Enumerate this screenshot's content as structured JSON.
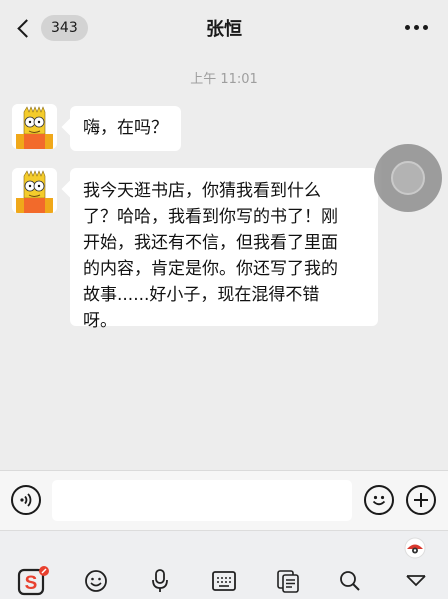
{
  "header": {
    "back_label": "343",
    "title": "张恒",
    "more_icon": "more-dots-icon"
  },
  "chat": {
    "timestamp": "上午 11:01",
    "messages": [
      {
        "sender": "contact",
        "text": "嗨，在吗？"
      },
      {
        "sender": "contact",
        "lines": [
          "我今天逛书店，你猜我看到什么",
          "了？哈哈，我看到你写的书了！刚",
          "开始，我还有不信，但我看了里面",
          "的内容，肯定是你。你还写了我的",
          "故事......好小子，现在混得不错",
          "呀。"
        ]
      }
    ]
  },
  "input_bar": {
    "value": "",
    "icons": [
      "voice-icon",
      "emoji-icon",
      "plus-icon"
    ]
  },
  "ime_toolbar": {
    "icons": [
      "sogou-logo-icon",
      "emoji-face-icon",
      "microphone-icon",
      "keyboard-icon",
      "clipboard-icon",
      "search-icon",
      "collapse-icon"
    ],
    "colors": {
      "logo_red": "#e8402f",
      "indicator_red": "#d9382e"
    }
  }
}
